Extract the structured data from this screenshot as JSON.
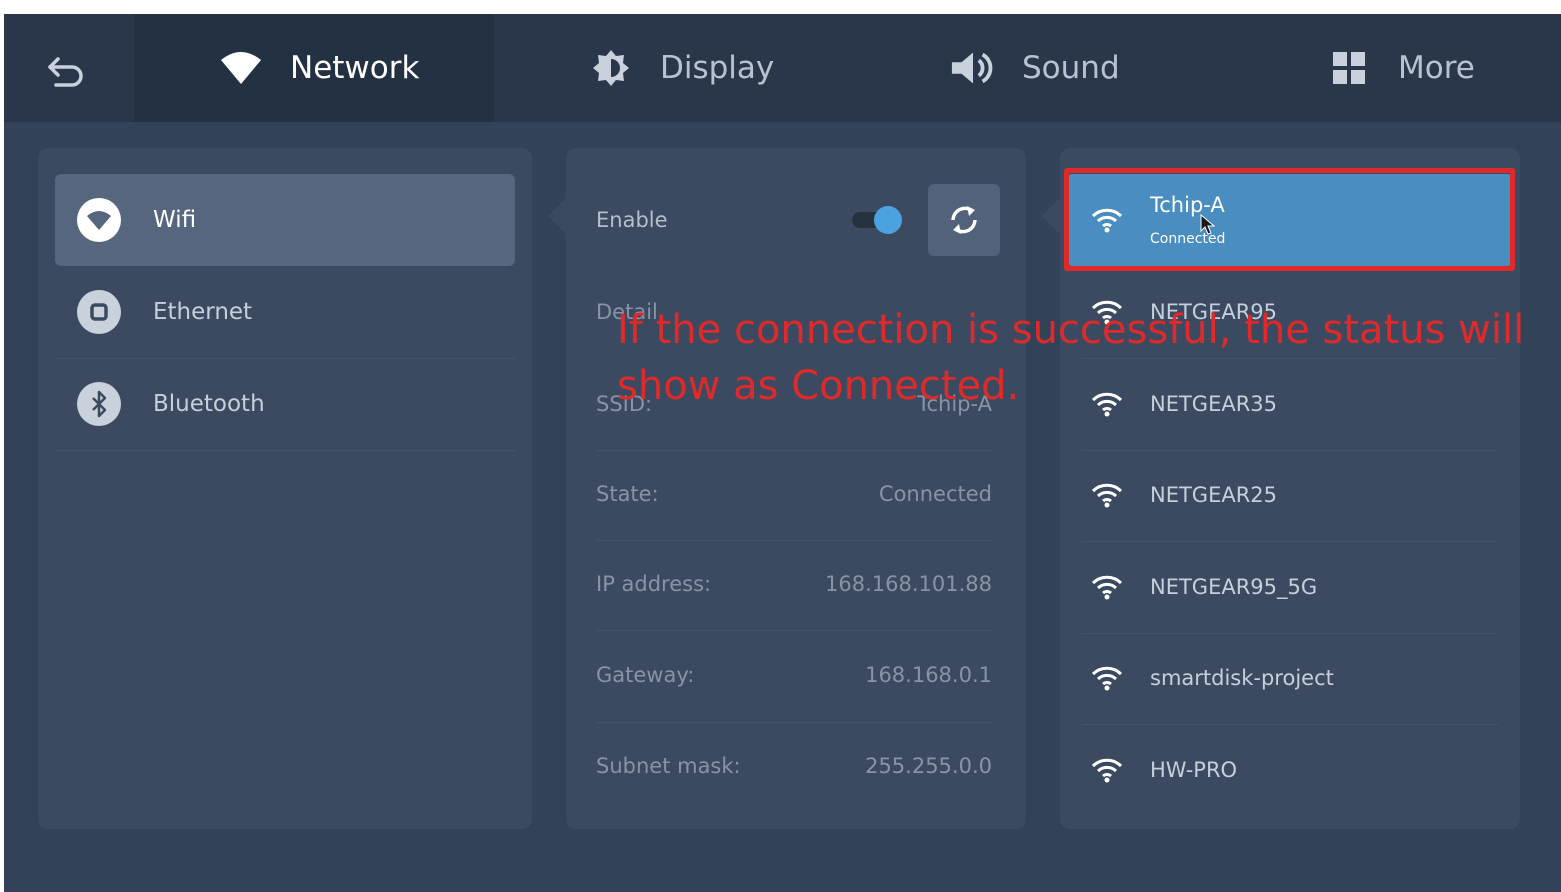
{
  "tabs": [
    {
      "label": "Network",
      "active": true,
      "icon": "wifi-icon"
    },
    {
      "label": "Display",
      "active": false,
      "icon": "display-icon"
    },
    {
      "label": "Sound",
      "active": false,
      "icon": "speaker-icon"
    },
    {
      "label": "More",
      "active": false,
      "icon": "grid-icon"
    }
  ],
  "sidebar": {
    "items": [
      {
        "label": "Wifi",
        "active": true,
        "icon": "wifi-icon"
      },
      {
        "label": "Ethernet",
        "active": false,
        "icon": "ethernet-icon"
      },
      {
        "label": "Bluetooth",
        "active": false,
        "icon": "bluetooth-icon"
      }
    ]
  },
  "detail": {
    "enable_label": "Enable",
    "enable_state": true,
    "detail_label": "Detail",
    "rows": [
      {
        "label": "SSID:",
        "value": "Tchip-A"
      },
      {
        "label": "State:",
        "value": "Connected"
      },
      {
        "label": "IP address:",
        "value": "168.168.101.88"
      },
      {
        "label": "Gateway:",
        "value": "168.168.0.1"
      },
      {
        "label": "Subnet mask:",
        "value": "255.255.0.0"
      }
    ]
  },
  "wifi_list": [
    {
      "ssid": "Tchip-A",
      "status": "Connected",
      "selected": true
    },
    {
      "ssid": "NETGEAR95",
      "status": "",
      "selected": false
    },
    {
      "ssid": "NETGEAR35",
      "status": "",
      "selected": false
    },
    {
      "ssid": "NETGEAR25",
      "status": "",
      "selected": false
    },
    {
      "ssid": "NETGEAR95_5G",
      "status": "",
      "selected": false
    },
    {
      "ssid": "smartdisk-project",
      "status": "",
      "selected": false
    },
    {
      "ssid": "HW-PRO",
      "status": "",
      "selected": false
    }
  ],
  "annotation": {
    "line1": "If the connection is successful, the status will",
    "line2": "show as Connected.",
    "color": "#e02a2a"
  },
  "colors": {
    "background": "#324258",
    "topbar": "#2a374b",
    "panel": "#3b4a60",
    "accent": "#4a8dc0",
    "highlight": "#e02a2a"
  }
}
